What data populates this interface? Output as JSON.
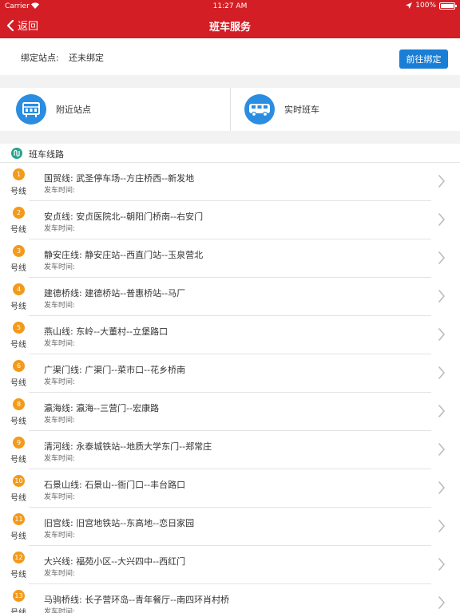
{
  "status": {
    "carrier": "Carrier",
    "time": "11:27 AM",
    "battery": "100%"
  },
  "nav": {
    "back_label": "返回",
    "title": "班车服务"
  },
  "binding": {
    "label": "绑定站点:",
    "value": "还未绑定",
    "button_label": "前往绑定"
  },
  "quick": {
    "nearby_label": "附近站点",
    "realtime_label": "实时班车"
  },
  "section": {
    "title": "班车线路"
  },
  "routes": [
    {
      "num": "1",
      "suffix": "号线",
      "name": "国贸线: 武圣停车场--方庄桥西--新发地",
      "time_label": "发车时间:"
    },
    {
      "num": "2",
      "suffix": "号线",
      "name": "安贞线: 安贞医院北--朝阳门桥南--右安门",
      "time_label": "发车时间:"
    },
    {
      "num": "3",
      "suffix": "号线",
      "name": "静安庄线: 静安庄站--西直门站--玉泉营北",
      "time_label": "发车时间:"
    },
    {
      "num": "4",
      "suffix": "号线",
      "name": "建德桥线: 建德桥站--普惠桥站--马厂",
      "time_label": "发车时间:"
    },
    {
      "num": "5",
      "suffix": "号线",
      "name": "燕山线: 东岭--大董村--立堡路口",
      "time_label": "发车时间:"
    },
    {
      "num": "6",
      "suffix": "号线",
      "name": "广渠门线: 广渠门--菜市口--花乡桥南",
      "time_label": "发车时间:"
    },
    {
      "num": "8",
      "suffix": "号线",
      "name": "瀛海线: 瀛海--三营门--宏康路",
      "time_label": "发车时间:"
    },
    {
      "num": "9",
      "suffix": "号线",
      "name": "清河线: 永泰城铁站--地质大学东门--郑常庄",
      "time_label": "发车时间:"
    },
    {
      "num": "10",
      "suffix": "号线",
      "name": "石景山线: 石景山--衙门口--丰台路口",
      "time_label": "发车时间:"
    },
    {
      "num": "11",
      "suffix": "号线",
      "name": "旧宫线: 旧宫地铁站--东高地--恋日家园",
      "time_label": "发车时间:"
    },
    {
      "num": "12",
      "suffix": "号线",
      "name": "大兴线: 福苑小区--大兴四中--西红门",
      "time_label": "发车时间:"
    },
    {
      "num": "13",
      "suffix": "号线",
      "name": "马驹桥线: 长子营环岛--青年餐厅--南四环肖村桥",
      "time_label": "发车时间:"
    }
  ],
  "colors": {
    "brand_red": "#d31e25",
    "accent_blue": "#1a7ed6",
    "route_badge": "#f39a1b",
    "section_icon": "#26a48c"
  },
  "icons": {
    "back": "chevron-left-icon",
    "nearby": "bus-stop-icon",
    "realtime": "bus-icon",
    "section": "route-icon",
    "row": "chevron-right-icon"
  }
}
